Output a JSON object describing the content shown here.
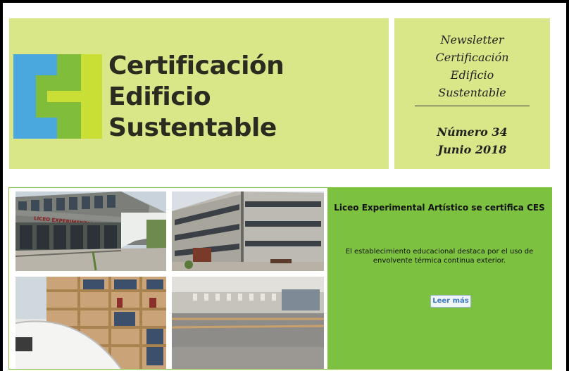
{
  "brand": {
    "line1": "Certificación",
    "line2": "Edificio",
    "line3": "Sustentable"
  },
  "newsletter": {
    "lines": [
      "Newsletter",
      "Certificación",
      "Edificio",
      "Sustentable"
    ],
    "issue_number": "Número 34",
    "issue_date": "Junio 2018"
  },
  "article": {
    "headline": "Liceo Experimental Artístico se certifica CES",
    "summary": "El establecimiento educacional destaca por el uso de envolvente térmica continua exterior.",
    "read_more_label": "Leer más",
    "building_sign": "LICEO EXPERIMENTAL"
  },
  "colors": {
    "header_bg": "#dae789",
    "article_panel_bg": "#7cc13f",
    "logo_blue": "#4aa8df",
    "logo_green": "#80bd3a",
    "logo_lime": "#c9df35"
  },
  "icons": [
    "ces-logo-icon"
  ]
}
